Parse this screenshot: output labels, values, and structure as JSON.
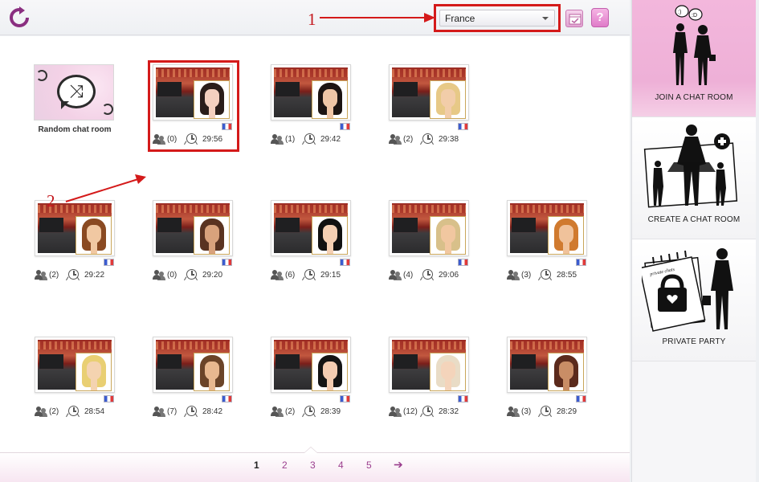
{
  "topbar": {
    "country_selected": "France",
    "annotation_1": "1"
  },
  "annotation_2": "2",
  "random_room": {
    "label": "Random chat room"
  },
  "rooms": [
    {
      "users": "(0)",
      "time": "29:56",
      "hair": "#2a1d1a",
      "skin": "#f4d0bf"
    },
    {
      "users": "(1)",
      "time": "29:42",
      "hair": "#1c1412",
      "skin": "#f0c6a6"
    },
    {
      "users": "(2)",
      "time": "29:38",
      "hair": "#e7c987",
      "skin": "#f2cda9"
    },
    {
      "users": "(2)",
      "time": "29:22",
      "hair": "#8a4a22",
      "skin": "#f1c8a2"
    },
    {
      "users": "(0)",
      "time": "29:20",
      "hair": "#5a3321",
      "skin": "#d9a27c"
    },
    {
      "users": "(6)",
      "time": "29:15",
      "hair": "#111111",
      "skin": "#f4cfb3"
    },
    {
      "users": "(4)",
      "time": "29:06",
      "hair": "#d8c08a",
      "skin": "#f1c7a0"
    },
    {
      "users": "(3)",
      "time": "28:55",
      "hair": "#d07a2f",
      "skin": "#f0c29b"
    },
    {
      "users": "(2)",
      "time": "28:54",
      "hair": "#e9cf73",
      "skin": "#f4d3b0"
    },
    {
      "users": "(7)",
      "time": "28:42",
      "hair": "#6b4428",
      "skin": "#e8b88f"
    },
    {
      "users": "(2)",
      "time": "28:39",
      "hair": "#141414",
      "skin": "#f3ccb1"
    },
    {
      "users": "(12)",
      "time": "28:32",
      "hair": "#e9dcc6",
      "skin": "#f4d4bb"
    },
    {
      "users": "(3)",
      "time": "28:29",
      "hair": "#5b2a1c",
      "skin": "#c98d66"
    }
  ],
  "pager": {
    "pages": [
      "1",
      "2",
      "3",
      "4",
      "5"
    ],
    "current": "1",
    "next_glyph": "➔"
  },
  "sidebar": {
    "join": "JOIN A CHAT ROOM",
    "create": "CREATE A CHAT ROOM",
    "private": "PRIVATE PARTY",
    "bubble_1": ":)",
    "bubble_2": ":D",
    "calendar_text": "private chats"
  },
  "colors": {
    "accent": "#9b3f8e",
    "annotation": "#d41a1a",
    "sidebar_active": "#f3b7dc"
  }
}
